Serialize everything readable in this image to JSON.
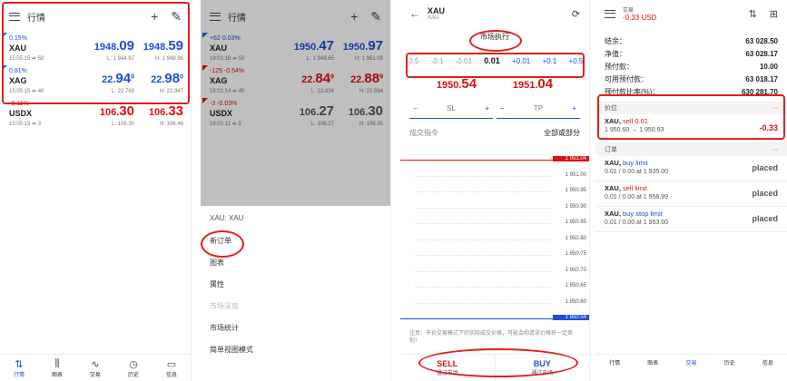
{
  "panel1": {
    "title": "行情",
    "quotes": [
      {
        "change": "0.15%",
        "symbol": "XAU",
        "meta": "15:05:15 ⇹ 50",
        "bid_a": "1948.",
        "bid_b": "09",
        "ask_a": "1948.",
        "ask_b": "59",
        "low": "L: 1 944.97",
        "high": "H: 1 948.96",
        "dir": "up"
      },
      {
        "change": "0.81%",
        "symbol": "XAG",
        "meta": "15:05:15 ⇹ 40",
        "bid_a": "22.",
        "bid_b": "94",
        "bid_sup": "0",
        "ask_a": "22.",
        "ask_b": "98",
        "ask_sup": "0",
        "low": "L: 22.768",
        "high": "H: 22.947",
        "dir": "up"
      },
      {
        "change": "-0.11%",
        "symbol": "USDX",
        "meta": "15:05:13 ⇹ 3",
        "bid_a": "106.",
        "bid_b": "30",
        "ask_a": "106.",
        "ask_b": "33",
        "low": "L: 106.30",
        "high": "H: 106.46",
        "dir": "down"
      }
    ]
  },
  "panel2": {
    "title": "行情",
    "quotes": [
      {
        "change": "+62 0.03%",
        "symbol": "XAU",
        "meta": "19:01:16 ⇹ 50",
        "bid_a": "1950.",
        "bid_b": "47",
        "ask_a": "1950.",
        "ask_b": "97",
        "low": "L: 1 948.65",
        "high": "H: 1 951.08"
      },
      {
        "change": "-125 -0.54%",
        "symbol": "XAG",
        "meta": "19:01:14 ⇹ 40",
        "bid_a": "22.",
        "bid_b": "84",
        "bid_sup": "9",
        "ask_a": "22.",
        "ask_b": "88",
        "ask_sup": "9",
        "low": "L: 22.834",
        "high": "H: 22.894"
      },
      {
        "change": "-3 -0.03%",
        "symbol": "USDX",
        "meta": "19:01:11 ⇹ 3",
        "bid_a": "106.",
        "bid_b": "27",
        "ask_a": "106.",
        "ask_b": "30",
        "low": "L: 106.27",
        "high": "H: 106.35"
      }
    ],
    "sheet_title": "XAU: XAU",
    "menu": [
      "新订单",
      "图表",
      "属性",
      "市场深度",
      "市场统计",
      "简单视图模式"
    ]
  },
  "panel3": {
    "symbol": "XAU",
    "symbol_sub": "XAU",
    "mode": "市场执行",
    "volumes": [
      "-0.5",
      "-0.1",
      "-0.01",
      "0.01",
      "+0.01",
      "+0.1",
      "+0.5"
    ],
    "sell_price_a": "1950.",
    "sell_price_b": "54",
    "buy_price_a": "1951.",
    "buy_price_b": "04",
    "sl_label": "SL",
    "tp_label": "TP",
    "fill_label": "成交指令",
    "fill_value": "全部或部分",
    "ticks": [
      "1 951.04",
      "1 951.00",
      "1 950.95",
      "1 950.90",
      "1 950.85",
      "1 950.80",
      "1 950.75",
      "1 950.70",
      "1 950.65",
      "1 950.60",
      "1 950.54"
    ],
    "note": "注意：市价交易模式下的实际成交价格，可能会和请求价格有一定差别！",
    "sell_label": "SELL",
    "sell_sub": "通过市场",
    "buy_label": "BUY",
    "buy_sub": "通过市场"
  },
  "panel4": {
    "title": "交易",
    "pnl": "-0.33 USD",
    "account": [
      {
        "k": "结余：",
        "v": "63 028.50"
      },
      {
        "k": "净值：",
        "v": "63 028.17"
      },
      {
        "k": "预付款：",
        "v": "10.00"
      },
      {
        "k": "可用预付款：",
        "v": "63 018.17"
      },
      {
        "k": "预付款比率(%)：",
        "v": "630 281.70"
      }
    ],
    "positions_label": "价位",
    "position": {
      "symbol": "XAU,",
      "side": "sell 0.01",
      "prices": "1 950.60 → 1 950.93",
      "profit": "-0.33"
    },
    "orders_label": "订单",
    "orders": [
      {
        "symbol": "XAU,",
        "type": "buy limit",
        "detail": "0.01 / 0.00 at 1 935.00",
        "status": "placed"
      },
      {
        "symbol": "XAU,",
        "type": "sell limit",
        "detail": "0.01 / 0.00 at 1 956.99",
        "status": "placed"
      },
      {
        "symbol": "XAU,",
        "type": "buy stop limit",
        "detail": "0.01 / 0.00 at 1 953.00",
        "status": "placed"
      }
    ]
  },
  "nav": [
    "行情",
    "图表",
    "交易",
    "历史",
    "信息"
  ]
}
